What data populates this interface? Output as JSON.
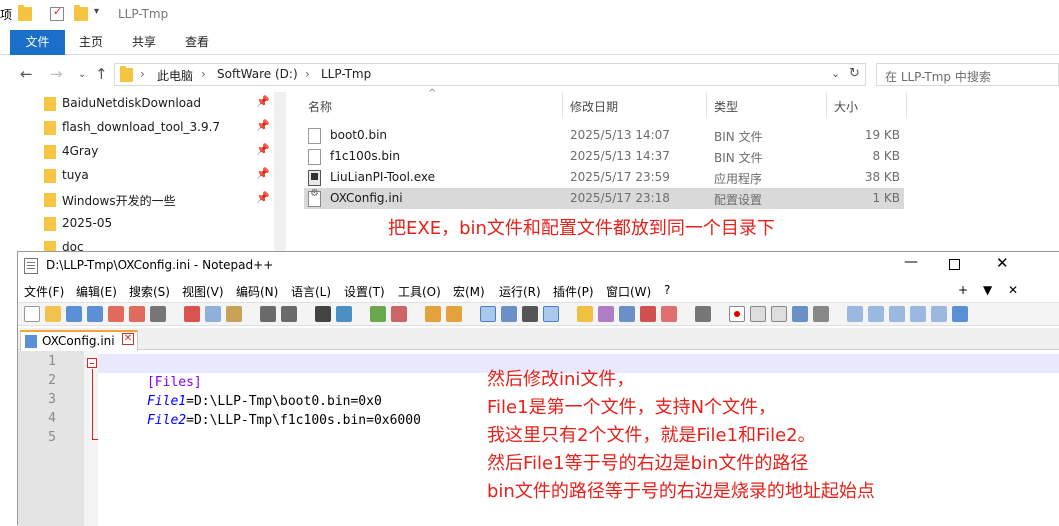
{
  "explorer": {
    "window_title": "LLP-Tmp",
    "ribbon_tabs": [
      "文件",
      "主页",
      "共享",
      "查看"
    ],
    "breadcrumb": [
      "此电脑",
      "SoftWare (D:)",
      "LLP-Tmp"
    ],
    "search_placeholder": "在 LLP-Tmp 中搜索",
    "edge_char": "项",
    "quick_access": [
      {
        "label": "BaiduNetdiskDownload",
        "pinned": true
      },
      {
        "label": "flash_download_tool_3.9.7",
        "pinned": true
      },
      {
        "label": "4Gray",
        "pinned": true
      },
      {
        "label": "tuya",
        "pinned": true
      },
      {
        "label": "Windows开发的一些",
        "pinned": true
      },
      {
        "label": "2025-05",
        "pinned": false
      },
      {
        "label": "doc",
        "pinned": false
      }
    ],
    "columns": {
      "name": "名称",
      "date": "修改日期",
      "type": "类型",
      "size": "大小"
    },
    "files": [
      {
        "name": "boot0.bin",
        "date": "2025/5/13 14:07",
        "type": "BIN 文件",
        "size": "19 KB",
        "icon": "file-icon"
      },
      {
        "name": "f1c100s.bin",
        "date": "2025/5/13 14:37",
        "type": "BIN 文件",
        "size": "8 KB",
        "icon": "file-icon"
      },
      {
        "name": "LiuLianPI-Tool.exe",
        "date": "2025/5/17 23:59",
        "type": "应用程序",
        "size": "38 KB",
        "icon": "exe-icon"
      },
      {
        "name": "OXConfig.ini",
        "date": "2025/5/17 23:18",
        "type": "配置设置",
        "size": "1 KB",
        "icon": "ini-icon",
        "selected": true
      }
    ]
  },
  "annotation_top": "把EXE，bin文件和配置文件都放到同一个目录下",
  "notepad": {
    "title": "D:\\LLP-Tmp\\OXConfig.ini - Notepad++",
    "menu": [
      "文件(F)",
      "编辑(E)",
      "搜索(S)",
      "视图(V)",
      "编码(N)",
      "语言(L)",
      "设置(T)",
      "工具(O)",
      "宏(M)",
      "运行(R)",
      "插件(P)",
      "窗口(W)",
      "?"
    ],
    "menu_right": [
      "+",
      "▼",
      "✕"
    ],
    "tab_label": "OXConfig.ini",
    "lines": [
      {
        "num": "1",
        "parts": [
          {
            "t": "[Files]",
            "c": "#8000ff"
          }
        ]
      },
      {
        "num": "2",
        "parts": [
          {
            "t": "File1",
            "c": "#0000ff",
            "i": true
          },
          {
            "t": "=",
            "c": "#000000"
          },
          {
            "t": "D:\\LLP-Tmp\\boot0.bin=0x0",
            "c": "#000000"
          }
        ]
      },
      {
        "num": "3",
        "parts": [
          {
            "t": "File2",
            "c": "#0000ff",
            "i": true
          },
          {
            "t": "=",
            "c": "#000000"
          },
          {
            "t": "D:\\LLP-Tmp\\f1c100s.bin=0x6000",
            "c": "#000000"
          }
        ]
      },
      {
        "num": "4",
        "parts": []
      },
      {
        "num": "5",
        "parts": []
      }
    ]
  },
  "annotation_lines": [
    "然后修改ini文件，",
    "File1是第一个文件，支持N个文件，",
    "我这里只有2个文件，就是File1和File2。",
    "然后File1等于号的右边是bin文件的路径",
    "bin文件的路径等于号的右边是烧录的地址起始点"
  ],
  "colors": {
    "accent": "#1a6fc8",
    "annotation": "#e8201a",
    "section": "#8000ff",
    "key": "#0000ff",
    "fold": "#e8201a"
  }
}
